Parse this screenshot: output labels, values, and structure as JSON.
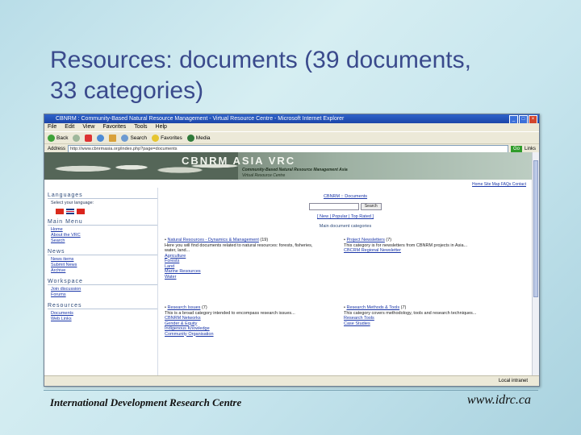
{
  "slide": {
    "title_line1": "Resources: documents (39 documents,",
    "title_line2": "33 categories)",
    "footer_left": "International Development Research Centre",
    "footer_right": "www.idrc.ca"
  },
  "browser": {
    "window_title": "CBNRM : Community-Based Natural Resource Management - Virtual Resource Centre - Microsoft Internet Explorer",
    "menu": [
      "File",
      "Edit",
      "View",
      "Favorites",
      "Tools",
      "Help"
    ],
    "toolbar": {
      "back": "Back",
      "search": "Search",
      "favorites": "Favorites",
      "media": "Media"
    },
    "address_label": "Address",
    "address_url": "http://www.cbnrmasia.org/index.php?page=documents",
    "go_label": "Go",
    "links_label": "Links",
    "status_text": "Local intranet"
  },
  "site": {
    "logo": "CBNRM ASIA VRC",
    "logo_sub1": "Community-Based Natural Resource Management Asia",
    "logo_sub2": "Virtual Resource Centre",
    "topnav": "Home  Site Map  FAQs  Contact",
    "sidebar": {
      "languages_heading": "Languages",
      "languages_text": "Select your language:",
      "main_menu_heading": "Main Menu",
      "main_menu": [
        "Home",
        "About the VRC",
        "Search"
      ],
      "news_heading": "News",
      "news": [
        "News items",
        "Submit News",
        "Archive"
      ],
      "workspace_heading": "Workspace",
      "workspace": [
        "Join discussion",
        "Forums"
      ],
      "resources_heading": "Resources",
      "resources": [
        "Documents",
        "Web Links"
      ]
    },
    "main": {
      "breadcrumb": "CBNRM :: Documents",
      "search_label": "Search",
      "sort_links": "[ New | Popular | Top Rated ]",
      "main_categories": "Main document categories",
      "categories": [
        {
          "title": "Natural Resources - Dynamics & Management",
          "count": "(19)",
          "desc": "Here you will find documents related to natural resources: forests, fisheries, water, land...",
          "subs": [
            "Agriculture",
            "Forests",
            "Land",
            "Marine Resources",
            "Water"
          ]
        },
        {
          "title": "Project Newsletters",
          "count": "(7)",
          "desc": "This category is for newsletters from CBNRM projects in Asia...",
          "subs": [
            "CBCRM Regional Newsletter"
          ]
        },
        {
          "title": "Research Issues",
          "count": "(7)",
          "desc": "This is a broad category intended to encompass research issues...",
          "subs": [
            "CBNRM Networks",
            "Gender & Equity",
            "Indigenous Knowledge",
            "Community Organisation"
          ]
        },
        {
          "title": "Research Methods & Tools",
          "count": "(7)",
          "desc": "This category covers methodology, tools and research techniques...",
          "subs": [
            "Research Tools",
            "Case Studies"
          ]
        }
      ]
    }
  },
  "colors": {
    "title": "#3a4a8c",
    "link": "#1a36a8",
    "titlebar": "#2e62c9"
  }
}
